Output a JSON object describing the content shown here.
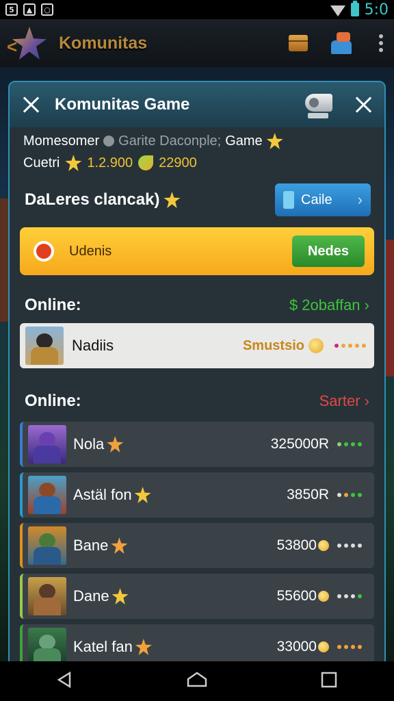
{
  "status_bar": {
    "time": "5:0"
  },
  "app_bar": {
    "title": "Komunitas"
  },
  "dialog": {
    "title": "Komunitas Game",
    "meta_line1": {
      "label": "Momesomer",
      "muted": "Garite Daconple;",
      "game": "Game"
    },
    "meta_line2": {
      "label": "Cuetri",
      "value1": "1.2.900",
      "value2": "22900"
    },
    "section_title": "DaLeres clancak)",
    "cale_button": "Caile",
    "banner": {
      "label": "Udenis",
      "button": "Nedes"
    },
    "online_1": {
      "title": "Online:",
      "link": "$ 2obaffan"
    },
    "featured": {
      "name": "Nadiis",
      "status": "Smustsio"
    },
    "online_2": {
      "title": "Online:",
      "link": "Sarter"
    },
    "players": [
      {
        "name": "Nola",
        "score": "325000R"
      },
      {
        "name": "Astäl fon",
        "score": "3850R"
      },
      {
        "name": "Bane",
        "score": "53800"
      },
      {
        "name": "Dane",
        "score": "55600"
      },
      {
        "name": "Katel fan",
        "score": "33000"
      }
    ]
  },
  "colors": {
    "accent_blue": "#2f8fb5",
    "banner_yellow": "#ffcf3a",
    "green_link": "#3fc43a",
    "red_link": "#e04848",
    "gold": "#f1c232"
  }
}
